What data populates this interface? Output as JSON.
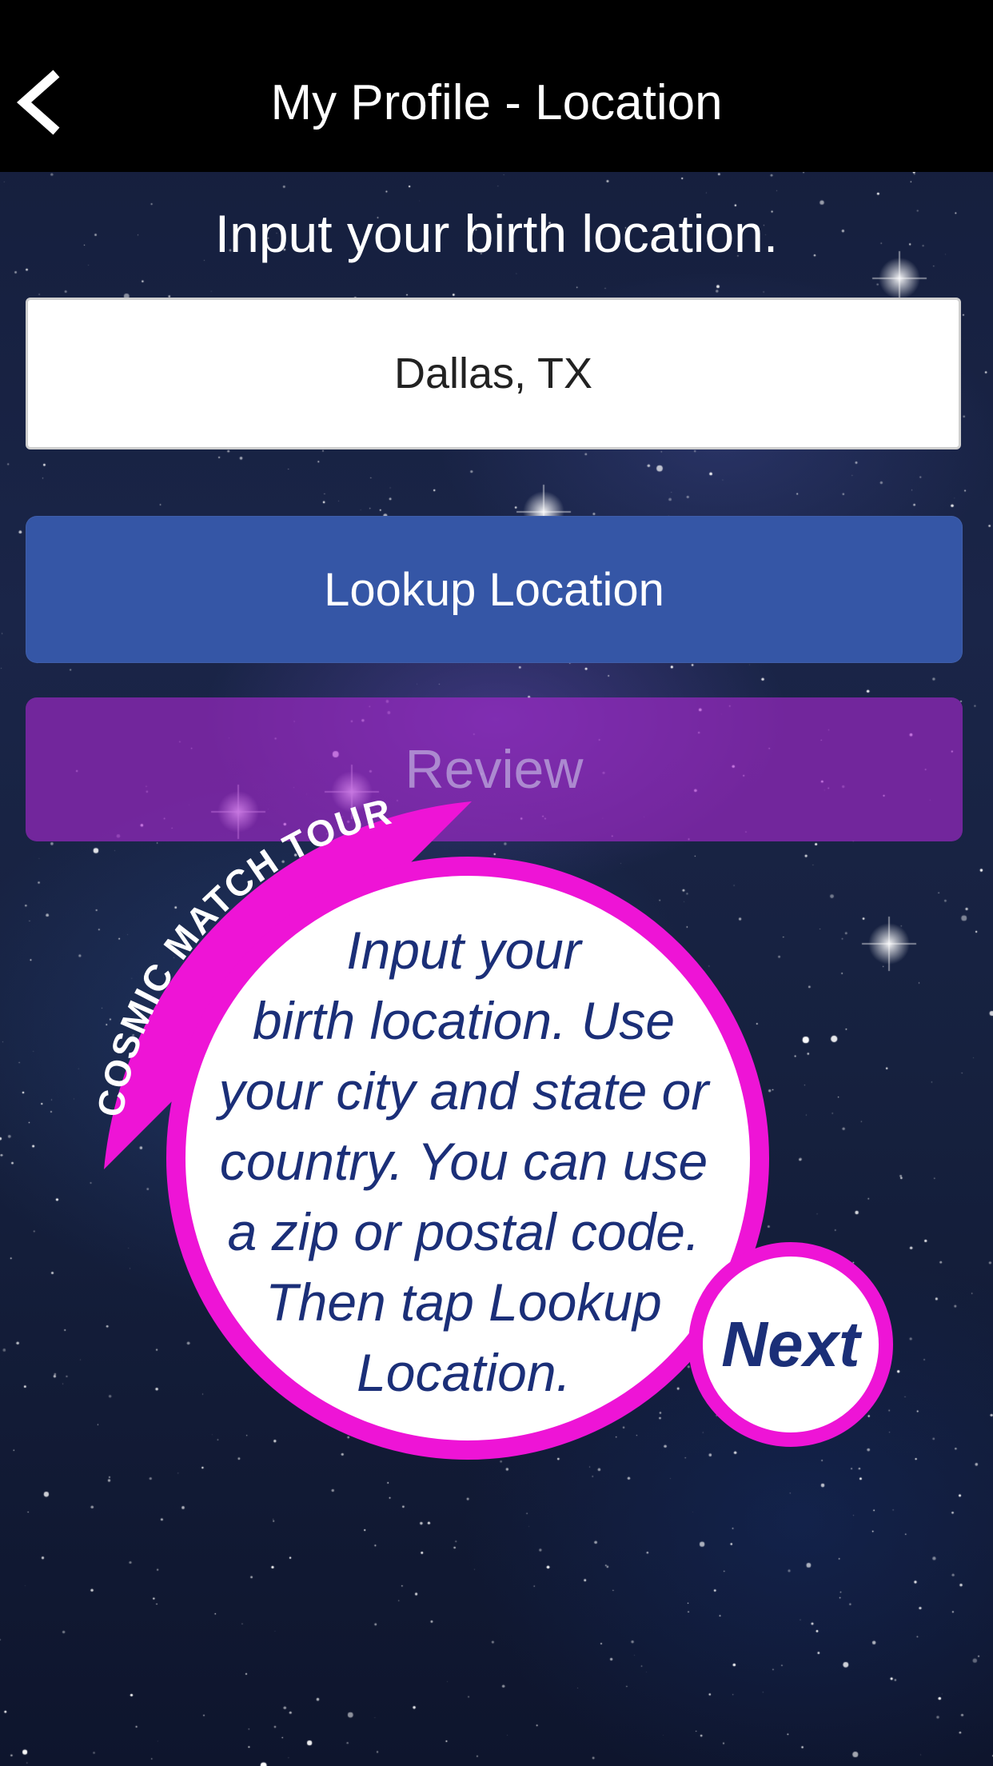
{
  "header": {
    "title": "My Profile - Location",
    "back_icon": "chevron-left-icon"
  },
  "main": {
    "prompt": "Input your birth location.",
    "location_input": {
      "value": "Dallas, TX"
    },
    "lookup_button": "Lookup Location",
    "review_button": "Review"
  },
  "tour": {
    "badge": "COSMIC MATCH TOUR",
    "message": "Input your\nbirth location. Use\nyour city and state or\ncountry. You can use\na zip or postal code.\nThen tap Lookup\nLocation.",
    "next_button": "Next"
  },
  "colors": {
    "header_bg": "#000000",
    "lookup_button": "#3556a6",
    "review_button": "#a828d2",
    "tour_accent": "#ee14d6",
    "tour_text": "#1b2f78"
  }
}
